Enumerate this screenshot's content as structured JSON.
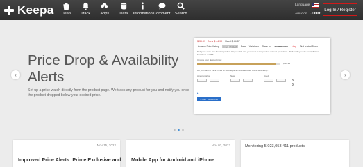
{
  "nav": {
    "logo": "Keepa",
    "items": [
      {
        "label": "Deals",
        "icon": "deals-bag-icon"
      },
      {
        "label": "Track",
        "icon": "bell-icon"
      },
      {
        "label": "Apps",
        "icon": "cloud-download-icon"
      },
      {
        "label": "Data",
        "icon": "database-icon"
      },
      {
        "label": "Information",
        "icon": "info-icon"
      },
      {
        "label": "Comment",
        "icon": "chat-bubble-icon"
      },
      {
        "label": "Search",
        "icon": "search-icon"
      }
    ],
    "language_label": "Language",
    "amazon_label": "Amazon",
    "amazon_domain": ".com",
    "login_label": "Log In / Register",
    "annotation_color": "#d01919"
  },
  "hero": {
    "headline": "Price Drop & Availability Alerts",
    "description": "Set up a price watch directly from the product page. We track any product for you and notify you once the product dropped below your desired price.",
    "slide_count": 3,
    "active_slide": 2
  },
  "screenshot_mockup": {
    "price_amazon": "$ 39.99",
    "price_new": "New $ 44.90",
    "price_used": "Used $ 44.87",
    "tabs": [
      "Amazon Price History",
      "Track product",
      "Data",
      "Variations",
      "Share on",
      "Find related Deals"
    ],
    "amazon_logo": "amazon.com",
    "ebay_logo": "ebay",
    "intro": "Notify me once any Amazon product list you wish and you've set in the product manual goes down. We'll notify you via email, Twitter, Facebook or RSS.",
    "choose_price": "Choose your desired price:",
    "slider_value": "$ 16.99",
    "list_sellers": "Do you want to track prices on Marketplace New and Used offers separately?",
    "col_new": "New",
    "col_used": "Used",
    "col_amazon": "Amazon price",
    "track_button": "START TRACKING"
  },
  "cards": [
    {
      "date": "Nov 15, 2022",
      "title": "Improved Price Alerts: Prime Exclusive and"
    },
    {
      "date": "Nov 03, 2022",
      "title": "Mobile App for Android and iPhone"
    },
    {
      "title": "Monitoring 5,023,053,411 products"
    }
  ]
}
